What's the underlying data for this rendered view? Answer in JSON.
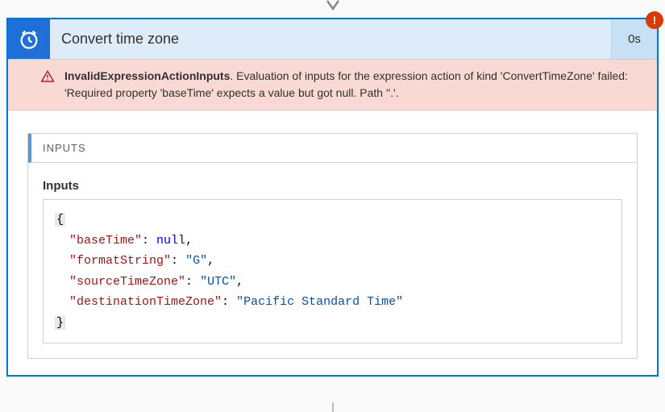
{
  "header": {
    "title": "Convert time zone",
    "duration": "0s"
  },
  "error": {
    "code": "InvalidExpressionActionInputs",
    "message": ". Evaluation of inputs for the expression action of kind 'ConvertTimeZone' failed: 'Required property 'baseTime' expects a value but got null. Path ''.'."
  },
  "inputs_section": {
    "header": "INPUTS",
    "label": "Inputs"
  },
  "inputs_payload": {
    "baseTime": null,
    "formatString": "G",
    "sourceTimeZone": "UTC",
    "destinationTimeZone": "Pacific Standard Time"
  },
  "code_render": {
    "k1": "\"baseTime\"",
    "v1": "null",
    "k2": "\"formatString\"",
    "v2": "\"G\"",
    "k3": "\"sourceTimeZone\"",
    "v3": "\"UTC\"",
    "k4": "\"destinationTimeZone\"",
    "v4": "\"Pacific Standard Time\""
  }
}
